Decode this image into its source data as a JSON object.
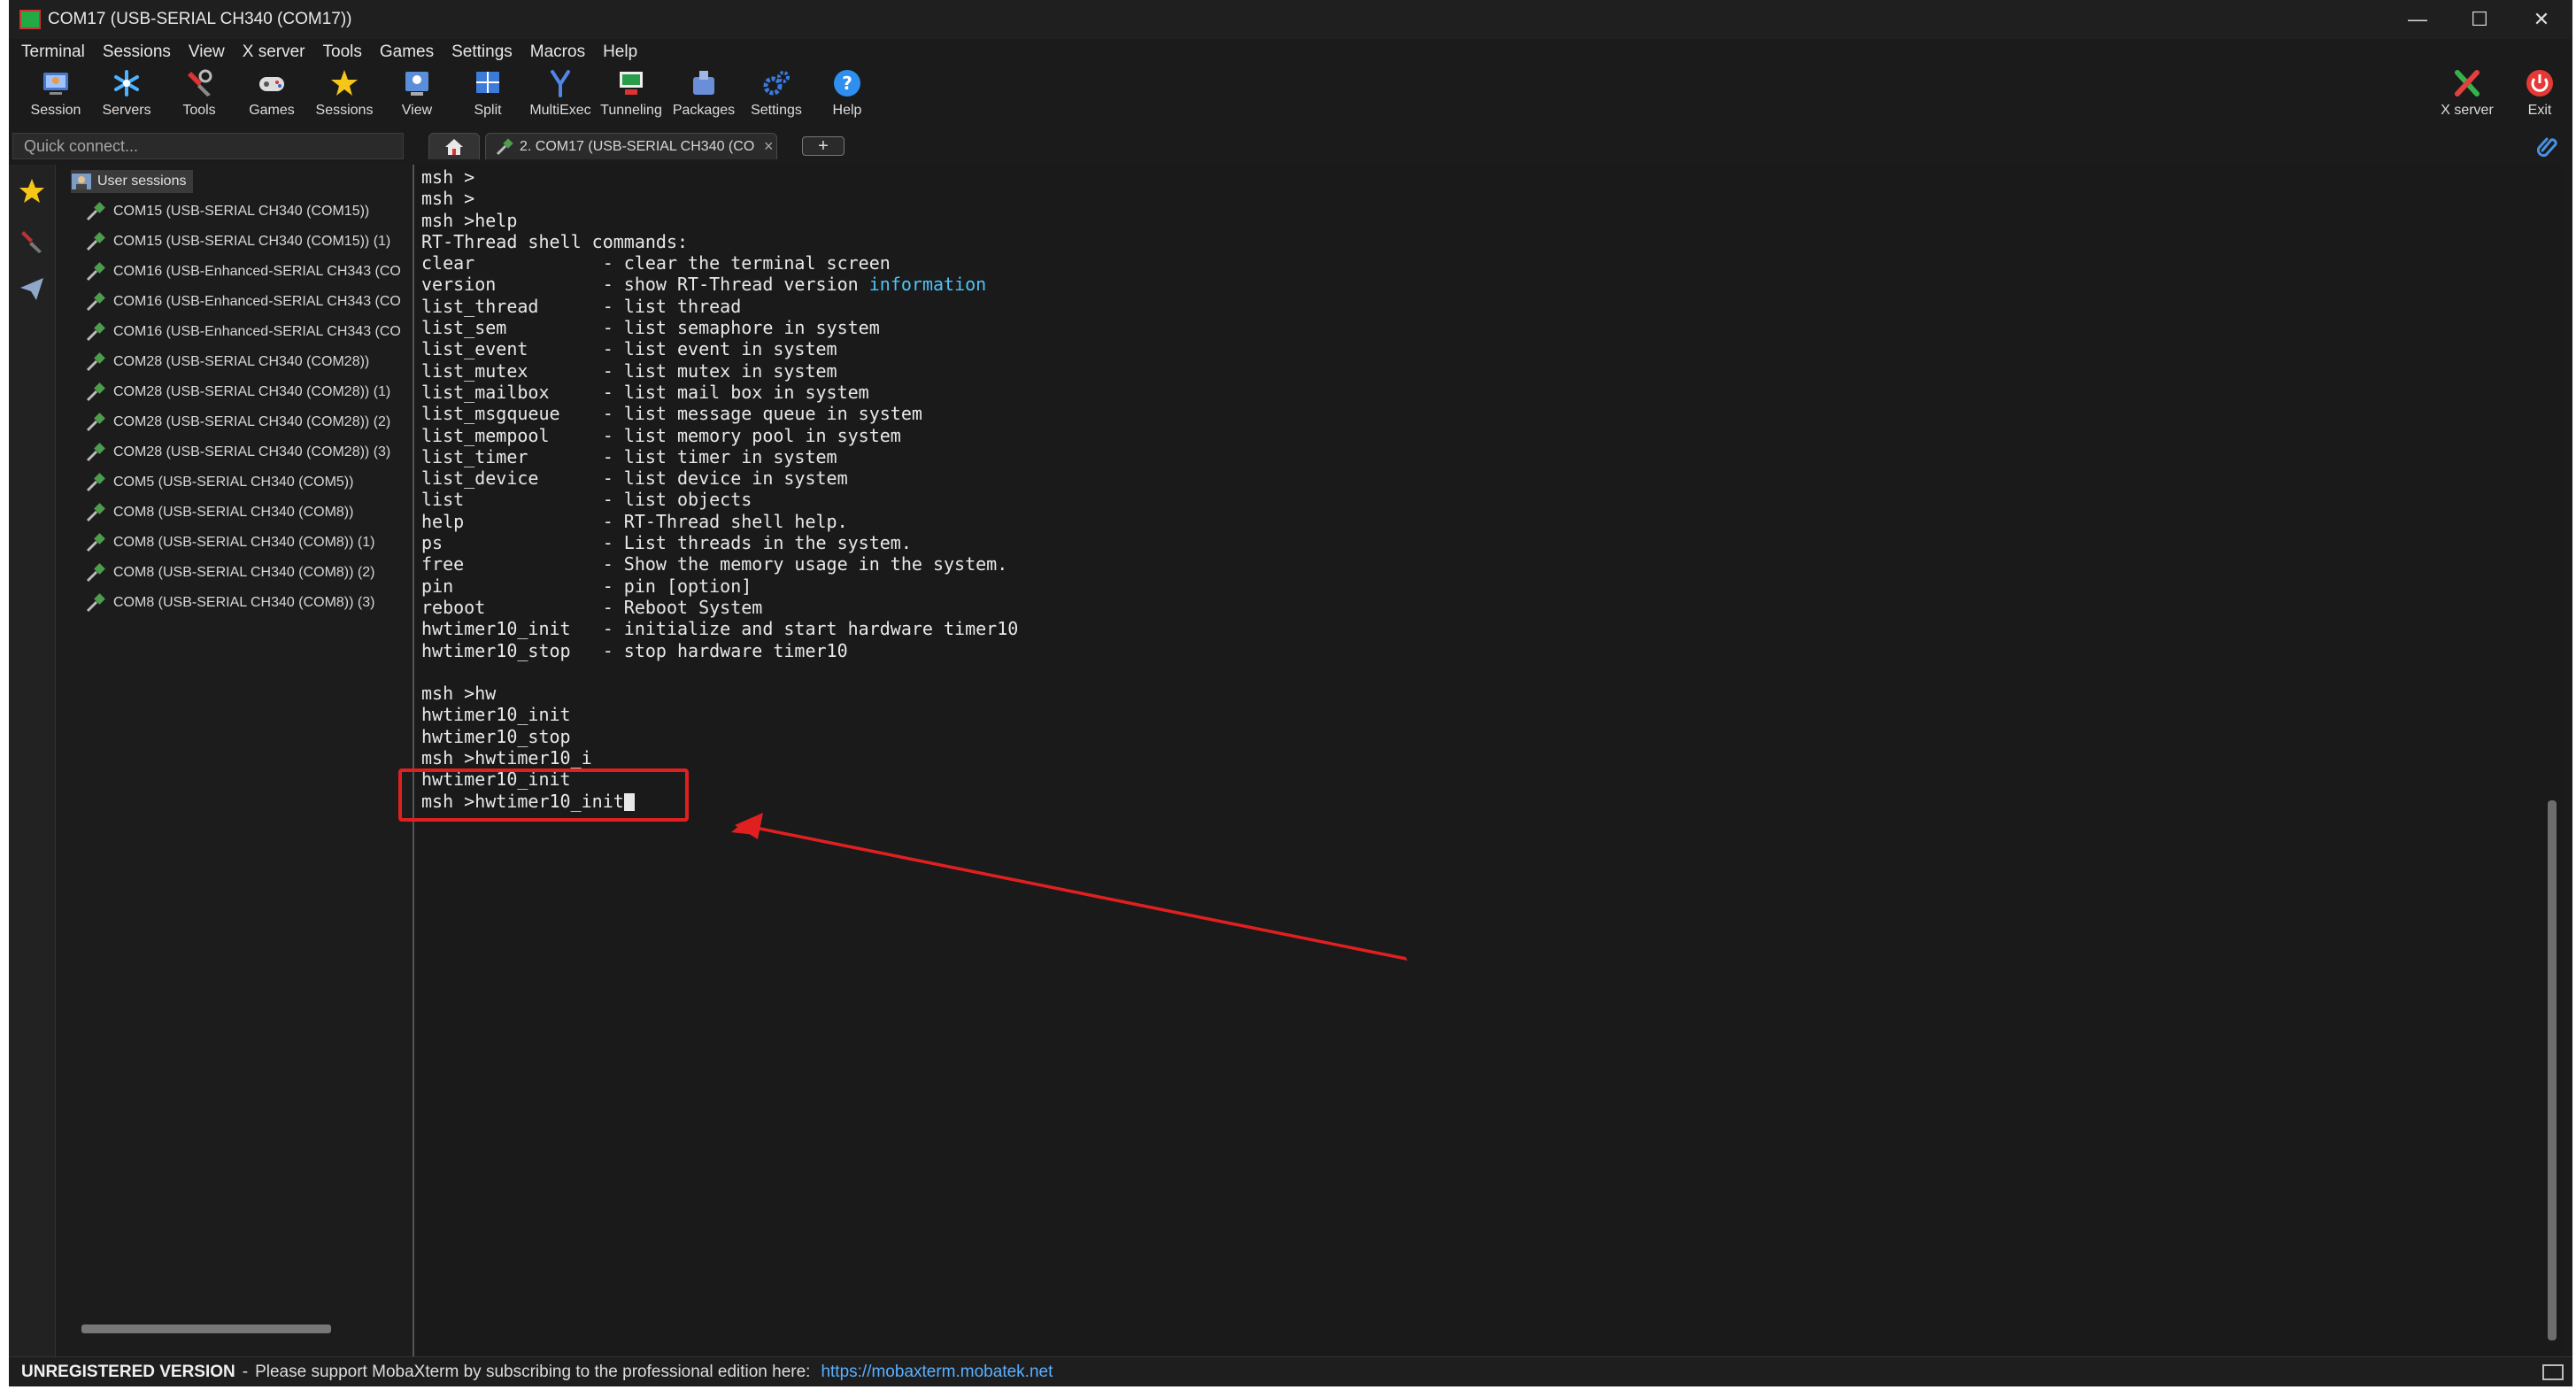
{
  "window": {
    "title": "COM17  (USB-SERIAL CH340 (COM17))",
    "controls": [
      "—",
      "☐",
      "✕"
    ]
  },
  "menu": [
    "Terminal",
    "Sessions",
    "View",
    "X server",
    "Tools",
    "Games",
    "Settings",
    "Macros",
    "Help"
  ],
  "toolbar": [
    {
      "label": "Session",
      "icon": "session-icon"
    },
    {
      "label": "Servers",
      "icon": "servers-icon"
    },
    {
      "label": "Tools",
      "icon": "tools-icon"
    },
    {
      "label": "Games",
      "icon": "games-icon"
    },
    {
      "label": "Sessions",
      "icon": "sessions-star-icon"
    },
    {
      "label": "View",
      "icon": "view-icon"
    },
    {
      "label": "Split",
      "icon": "split-icon"
    },
    {
      "label": "MultiExec",
      "icon": "multiexec-icon"
    },
    {
      "label": "Tunneling",
      "icon": "tunneling-icon"
    },
    {
      "label": "Packages",
      "icon": "packages-icon"
    },
    {
      "label": "Settings",
      "icon": "settings-icon"
    },
    {
      "label": "Help",
      "icon": "help-icon"
    }
  ],
  "toolbar_right": [
    {
      "label": "X server",
      "icon": "xserver-icon"
    },
    {
      "label": "Exit",
      "icon": "exit-icon"
    }
  ],
  "quick_connect": {
    "placeholder": "Quick connect..."
  },
  "tabs": {
    "active": "2. COM17  (USB-SERIAL CH340 (CO",
    "close": "×",
    "new": "+"
  },
  "sessions_panel": {
    "root": "User sessions",
    "items": [
      "COM15  (USB-SERIAL CH340 (COM15))",
      "COM15  (USB-SERIAL CH340 (COM15)) (1)",
      "COM16  (USB-Enhanced-SERIAL CH343 (CO",
      "COM16  (USB-Enhanced-SERIAL CH343 (CO",
      "COM16  (USB-Enhanced-SERIAL CH343 (CO",
      "COM28  (USB-SERIAL CH340 (COM28))",
      "COM28  (USB-SERIAL CH340 (COM28)) (1)",
      "COM28  (USB-SERIAL CH340 (COM28)) (2)",
      "COM28  (USB-SERIAL CH340 (COM28)) (3)",
      "COM5  (USB-SERIAL CH340 (COM5))",
      "COM8  (USB-SERIAL CH340 (COM8))",
      "COM8  (USB-SERIAL CH340 (COM8)) (1)",
      "COM8  (USB-SERIAL CH340 (COM8)) (2)",
      "COM8  (USB-SERIAL CH340 (COM8)) (3)"
    ]
  },
  "terminal": {
    "lines": [
      "msh >",
      "msh >",
      "msh >help",
      "RT-Thread shell commands:",
      "clear            - clear the terminal screen",
      "version          - show RT-Thread version ",
      "list_thread      - list thread",
      "list_sem         - list semaphore in system",
      "list_event       - list event in system",
      "list_mutex       - list mutex in system",
      "list_mailbox     - list mail box in system",
      "list_msgqueue    - list message queue in system",
      "list_mempool     - list memory pool in system",
      "list_timer       - list timer in system",
      "list_device      - list device in system",
      "list             - list objects",
      "help             - RT-Thread shell help.",
      "ps               - List threads in the system.",
      "free             - Show the memory usage in the system.",
      "pin              - pin [option]",
      "reboot           - Reboot System",
      "hwtimer10_init   - initialize and start hardware timer10",
      "hwtimer10_stop   - stop hardware timer10",
      "",
      "msh >hw",
      "hwtimer10_init",
      "hwtimer10_stop",
      "msh >hwtimer10_i",
      "hwtimer10_init",
      "msh >hwtimer10_init"
    ],
    "highlight_word": "information",
    "highlight_color": "#4fc3f7"
  },
  "status_bar": {
    "title": "UNREGISTERED VERSION",
    "separator": "-",
    "message": "Please support MobaXterm by subscribing to the professional edition here:",
    "link": "https://mobaxterm.mobatek.net"
  },
  "colors": {
    "annotation_red": "#e02020",
    "link_blue": "#5ab0ff"
  }
}
